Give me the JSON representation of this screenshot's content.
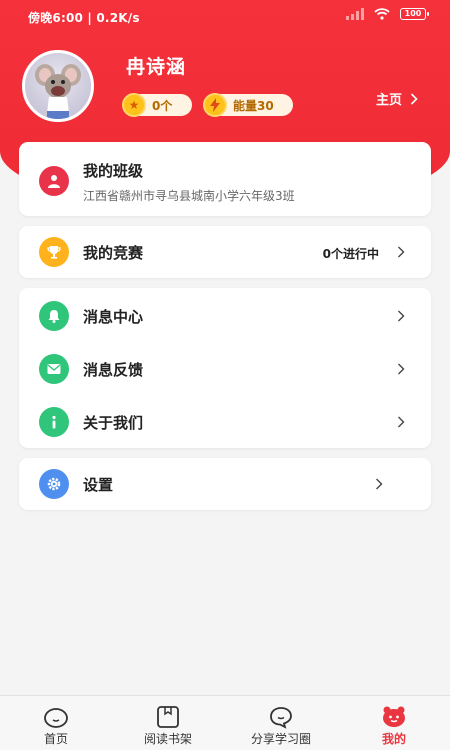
{
  "status_bar": {
    "time_text": "傍晚6:00 | 0.2K/s",
    "battery": "100"
  },
  "profile": {
    "name": "冉诗涵",
    "coins": "0个",
    "energy": "能量30",
    "home_link": "主页"
  },
  "class_card": {
    "title": "我的班级",
    "subtitle": "江西省赣州市寻乌县城南小学六年级3班"
  },
  "contest_card": {
    "title": "我的竞赛",
    "status": "0个进行中"
  },
  "menu": [
    {
      "label": "消息中心",
      "icon": "bell-icon"
    },
    {
      "label": "消息反馈",
      "icon": "mail-icon"
    },
    {
      "label": "关于我们",
      "icon": "info-icon"
    }
  ],
  "settings": {
    "label": "设置",
    "icon": "gear-icon"
  },
  "tabbar": [
    {
      "label": "首页",
      "icon": "home-face-icon",
      "active": false
    },
    {
      "label": "阅读书架",
      "icon": "bookshelf-icon",
      "active": false
    },
    {
      "label": "分享学习圈",
      "icon": "chat-bubble-icon",
      "active": false
    },
    {
      "label": "我的",
      "icon": "profile-face-icon",
      "active": true
    }
  ],
  "colors": {
    "primary": "#ee2b35",
    "accent_orange": "#ffb21c",
    "green": "#2fc57a",
    "blue": "#4f8ff0",
    "tab_active": "#e93640"
  }
}
